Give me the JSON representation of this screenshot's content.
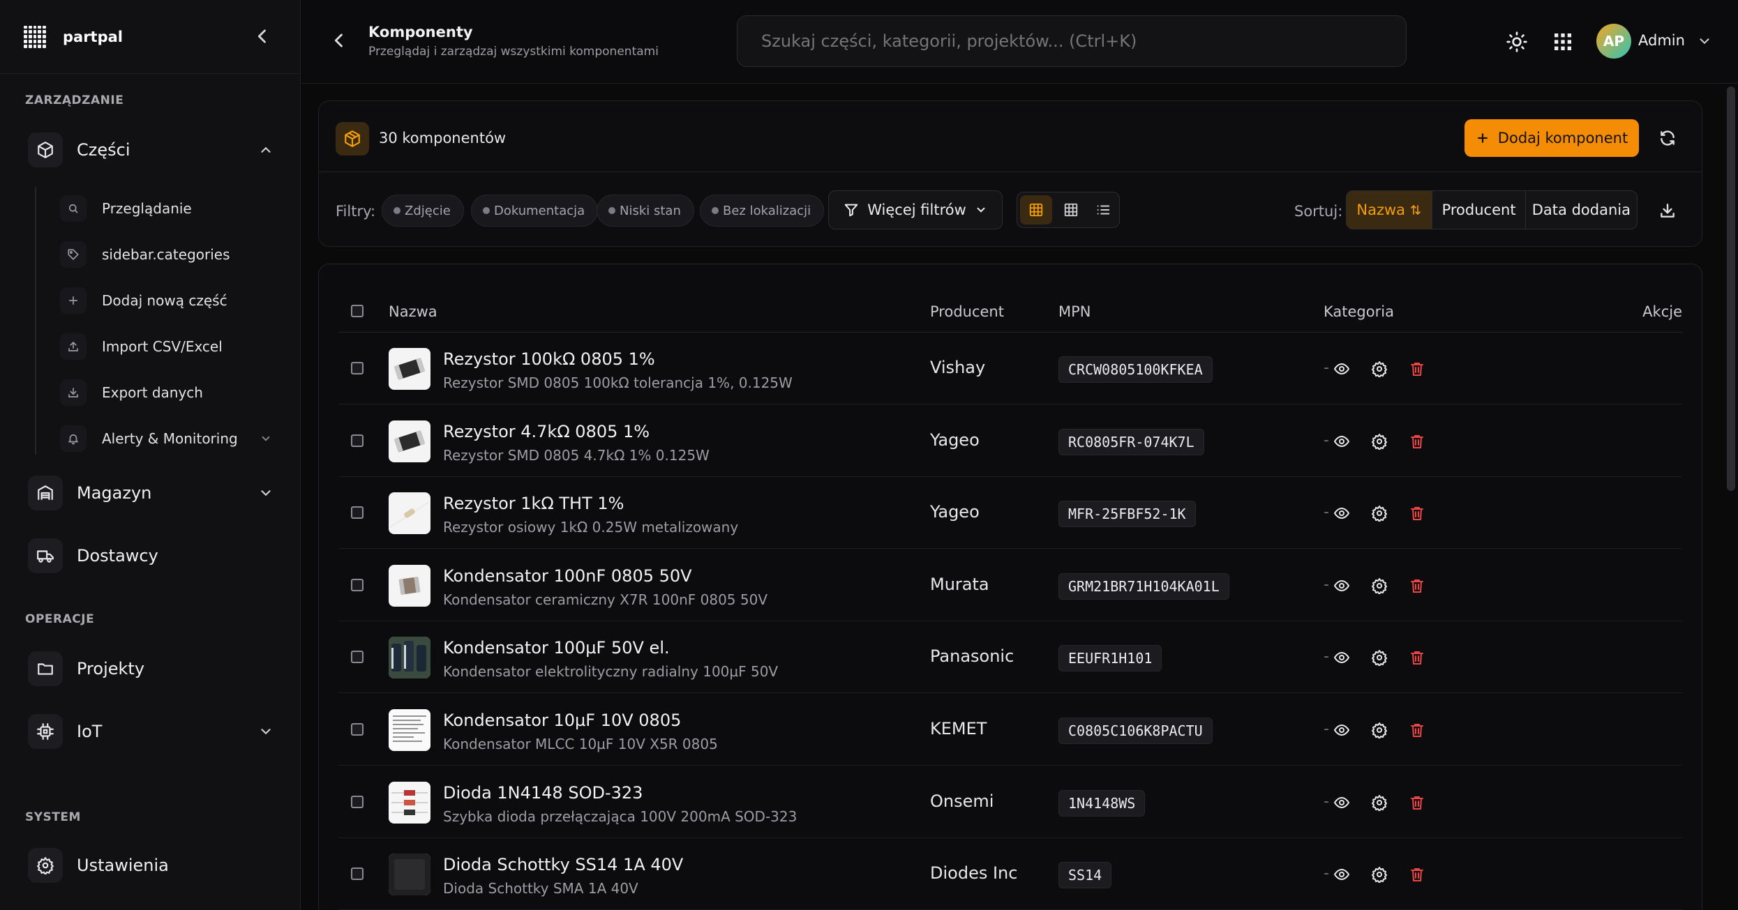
{
  "brand": {
    "name": "partpal"
  },
  "sidebar": {
    "sections": {
      "management": "ZARZĄDZANIE",
      "operations": "OPERACJE",
      "system": "SYSTEM"
    },
    "parts": {
      "label": "Części"
    },
    "sub_items": [
      {
        "label": "Przeglądanie",
        "icon": "search-icon"
      },
      {
        "label": "sidebar.categories",
        "icon": "tag-icon"
      },
      {
        "label": "Dodaj nową część",
        "icon": "plus-icon"
      },
      {
        "label": "Import CSV/Excel",
        "icon": "upload-icon"
      },
      {
        "label": "Export danych",
        "icon": "download-icon"
      },
      {
        "label": "Alerty & Monitoring",
        "icon": "bell-icon"
      }
    ],
    "warehouse": {
      "label": "Magazyn"
    },
    "suppliers": {
      "label": "Dostawcy"
    },
    "projects": {
      "label": "Projekty"
    },
    "iot": {
      "label": "IoT"
    },
    "settings": {
      "label": "Ustawienia"
    }
  },
  "header": {
    "title": "Komponenty",
    "subtitle": "Przeglądaj i zarządzaj wszystkimi komponentami",
    "search_placeholder": "Szukaj części, kategorii, projektów... (Ctrl+K)",
    "user": {
      "initials": "AP",
      "name": "Admin"
    }
  },
  "toolbar": {
    "count_label": "30 komponentów",
    "add_label": "Dodaj komponent",
    "filters_label": "Filtry:",
    "chips": [
      "Zdjęcie",
      "Dokumentacja",
      "Niski stan",
      "Bez lokalizacji"
    ],
    "more_filters": "Więcej filtrów",
    "sort_label": "Sortuj:",
    "sort_options": [
      "Nazwa",
      "Producent",
      "Data dodania"
    ],
    "sort_active": "Nazwa",
    "accent": "#f59e0b"
  },
  "table": {
    "headers": {
      "name": "Nazwa",
      "manufacturer": "Producent",
      "mpn": "MPN",
      "category": "Kategoria",
      "actions": "Akcje"
    },
    "rows": [
      {
        "name": "Rezystor 100kΩ 0805 1%",
        "desc": "Rezystor SMD 0805 100kΩ tolerancja 1%, 0.125W",
        "manufacturer": "Vishay",
        "mpn": "CRCW0805100KFKEA",
        "category": "-",
        "thumb": "smd-resistor"
      },
      {
        "name": "Rezystor 4.7kΩ 0805 1%",
        "desc": "Rezystor SMD 0805 4.7kΩ 1% 0.125W",
        "manufacturer": "Yageo",
        "mpn": "RC0805FR-074K7L",
        "category": "-",
        "thumb": "smd-resistor"
      },
      {
        "name": "Rezystor 1kΩ THT 1%",
        "desc": "Rezystor osiowy 1kΩ 0.25W metalizowany",
        "manufacturer": "Yageo",
        "mpn": "MFR-25FBF52-1K",
        "category": "-",
        "thumb": "axial-resistor"
      },
      {
        "name": "Kondensator 100nF 0805 50V",
        "desc": "Kondensator ceramiczny X7R 100nF 0805 50V",
        "manufacturer": "Murata",
        "mpn": "GRM21BR71H104KA01L",
        "category": "-",
        "thumb": "mlcc"
      },
      {
        "name": "Kondensator 100µF 50V el.",
        "desc": "Kondensator elektrolityczny radialny 100µF 50V",
        "manufacturer": "Panasonic",
        "mpn": "EEUFR1H101",
        "category": "-",
        "thumb": "electrolytic"
      },
      {
        "name": "Kondensator 10µF 10V 0805",
        "desc": "Kondensator MLCC 10µF 10V X5R 0805",
        "manufacturer": "KEMET",
        "mpn": "C0805C106K8PACTU",
        "category": "-",
        "thumb": "datasheet"
      },
      {
        "name": "Dioda 1N4148 SOD-323",
        "desc": "Szybka dioda przełączająca 100V 200mA SOD-323",
        "manufacturer": "Onsemi",
        "mpn": "1N4148WS",
        "category": "-",
        "thumb": "diode"
      },
      {
        "name": "Dioda Schottky SS14 1A 40V",
        "desc": "Dioda Schottky SMA 1A 40V",
        "manufacturer": "Diodes Inc",
        "mpn": "SS14",
        "category": "-",
        "thumb": "dark-chip"
      }
    ]
  }
}
